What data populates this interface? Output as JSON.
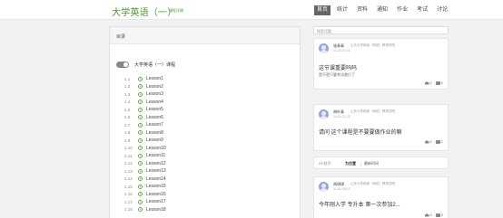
{
  "header": {
    "course_title": "大学英语（一）",
    "course_sub": "课程详情",
    "nav": [
      "首页",
      "统计",
      "资料",
      "通知",
      "作业",
      "考试",
      "讨论"
    ]
  },
  "catalog": {
    "title": "目录",
    "course_name": "大学英语（一）课程",
    "lessons": [
      {
        "num": "1.1",
        "label": "Lesson1"
      },
      {
        "num": "1.2",
        "label": "Lesson2"
      },
      {
        "num": "1.3",
        "label": "Lesson3"
      },
      {
        "num": "1.4",
        "label": "Lesson4"
      },
      {
        "num": "1.5",
        "label": "Lesson5"
      },
      {
        "num": "1.6",
        "label": "Lesson6"
      },
      {
        "num": "1.7",
        "label": "Lesson7"
      },
      {
        "num": "1.8",
        "label": "Lesson8"
      },
      {
        "num": "1.9",
        "label": "Lesson9"
      },
      {
        "num": "1.10",
        "label": "Lesson10"
      },
      {
        "num": "1.11",
        "label": "Lesson11"
      },
      {
        "num": "1.12",
        "label": "Lesson12"
      },
      {
        "num": "1.13",
        "label": "Lesson13"
      },
      {
        "num": "1.14",
        "label": "Lesson14"
      },
      {
        "num": "1.15",
        "label": "Lesson15"
      },
      {
        "num": "1.16",
        "label": "Lesson16"
      },
      {
        "num": "1.17",
        "label": "Lesson17"
      },
      {
        "num": "1.18",
        "label": "Lesson18"
      }
    ]
  },
  "discussion": {
    "search_placeholder": "搜索话题",
    "posts": [
      {
        "user": "张青青",
        "school": "山东大学继续（网络）教育学院",
        "time": "11-02 07:44",
        "title": "这节课重要吗吗",
        "body": "是不是只要考试就行了",
        "likes": "0",
        "comments": "0"
      },
      {
        "user": "胡叶青",
        "school": "山东大学继续（网络）教育学院",
        "time": "10-31 11:13",
        "title": "请问 这个课程是不要要做作业的嘛",
        "body": "",
        "likes": "0",
        "comments": "2"
      },
      {
        "user": "胡琪琪",
        "school": "山东大学继续（网络）教育学院",
        "time": "11-01 08:42",
        "title": "今年刚入学 专升本 第一次参加2...",
        "body": "",
        "likes": "0",
        "comments": "3"
      }
    ],
    "sort": {
      "count": "23 帖子",
      "latest": "为位置",
      "separator": "|",
      "hot": "最新时间"
    }
  },
  "colors": {
    "brand_green": "#4c9a2a",
    "nav_active_bg": "#666666",
    "toggle": "#888888"
  }
}
